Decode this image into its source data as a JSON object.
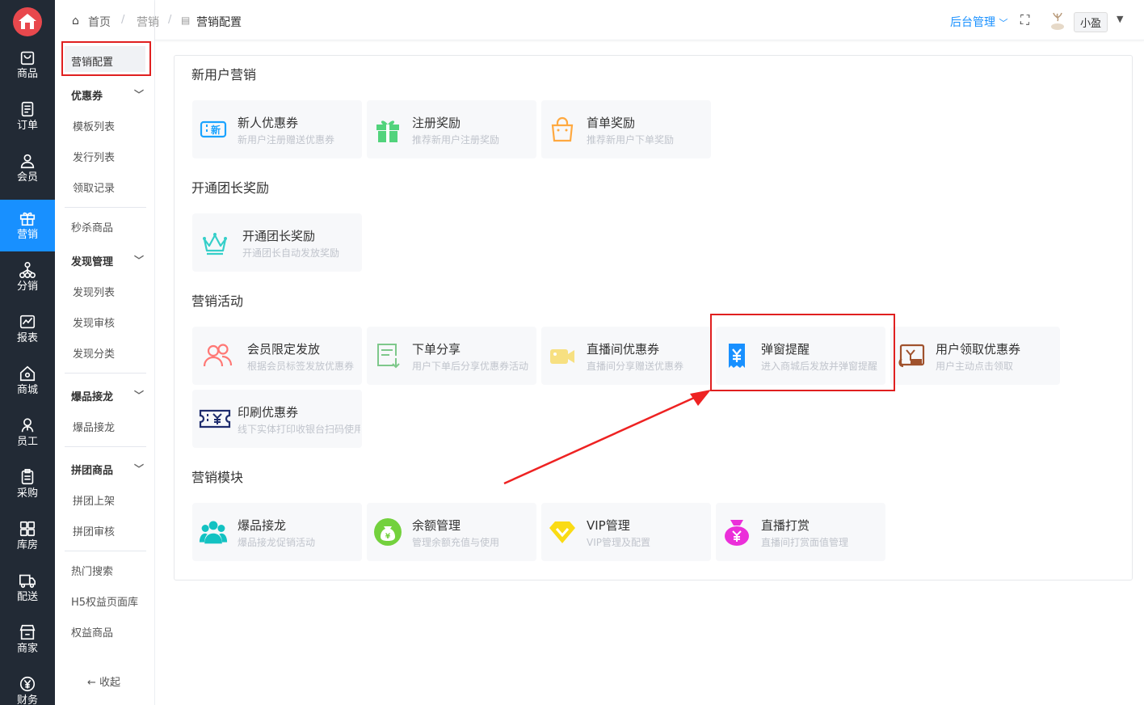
{
  "rail": {
    "items": [
      {
        "label": "商品",
        "icon": "bag-icon"
      },
      {
        "label": "订单",
        "icon": "order-icon"
      },
      {
        "label": "会员",
        "icon": "user-icon"
      },
      {
        "label": "营销",
        "icon": "gift-icon",
        "active": true
      },
      {
        "label": "分销",
        "icon": "network-icon"
      },
      {
        "label": "报表",
        "icon": "chart-icon"
      },
      {
        "label": "商城",
        "icon": "home-icon"
      },
      {
        "label": "员工",
        "icon": "staff-icon"
      },
      {
        "label": "采购",
        "icon": "clipboard-icon"
      },
      {
        "label": "库房",
        "icon": "warehouse-icon"
      },
      {
        "label": "配送",
        "icon": "truck-icon"
      },
      {
        "label": "商家",
        "icon": "store-icon"
      },
      {
        "label": "财务",
        "icon": "yen-icon"
      }
    ]
  },
  "subnav": {
    "selected": "营销配置",
    "groups": [
      {
        "title": "优惠券",
        "items": [
          "模板列表",
          "发行列表",
          "领取记录"
        ]
      },
      {
        "title": "秒杀商品",
        "items": []
      },
      {
        "title": "发现管理",
        "items": [
          "发现列表",
          "发现审核",
          "发现分类"
        ]
      },
      {
        "title": "爆品接龙",
        "items": [
          "爆品接龙"
        ]
      },
      {
        "title": "拼团商品",
        "items": [
          "拼团上架",
          "拼团审核"
        ]
      }
    ],
    "extras": [
      "热门搜索",
      "H5权益页面库",
      "权益商品"
    ],
    "collapse": "收起"
  },
  "topbar": {
    "breadcrumb": [
      "首页",
      "营销",
      "营销配置"
    ],
    "admin_menu": "后台管理",
    "username": "小盈"
  },
  "sections": [
    {
      "title": "新用户营销",
      "cards": [
        {
          "title": "新人优惠券",
          "desc": "新用户注册赠送优惠券",
          "icon": "new-coupon-icon"
        },
        {
          "title": "注册奖励",
          "desc": "推荐新用户注册奖励",
          "icon": "gift-box-icon"
        },
        {
          "title": "首单奖励",
          "desc": "推荐新用户下单奖励",
          "icon": "shopping-bag-icon"
        }
      ]
    },
    {
      "title": "开通团长奖励",
      "cards": [
        {
          "title": "开通团长奖励",
          "desc": "开通团长自动发放奖励",
          "icon": "crown-icon"
        }
      ]
    },
    {
      "title": "营销活动",
      "cards": [
        {
          "title": "会员限定发放",
          "desc": "根据会员标签发放优惠券",
          "icon": "members-icon"
        },
        {
          "title": "下单分享",
          "desc": "用户下单后分享优惠券活动",
          "icon": "share-download-icon"
        },
        {
          "title": "直播间优惠券",
          "desc": "直播间分享赠送优惠券",
          "icon": "video-camera-icon"
        },
        {
          "title": "弹窗提醒",
          "desc": "进入商城后发放并弹窗提醒",
          "icon": "yen-receipt-icon"
        },
        {
          "title": "用户领取优惠券",
          "desc": "用户主动点击领取",
          "icon": "coupon-wallet-icon"
        },
        {
          "title": "印刷优惠券",
          "desc": "线下实体打印收银台扫码使用",
          "icon": "printed-coupon-icon"
        }
      ]
    },
    {
      "title": "营销模块",
      "cards": [
        {
          "title": "爆品接龙",
          "desc": "爆品接龙促销活动",
          "icon": "group-icon"
        },
        {
          "title": "余额管理",
          "desc": "管理余额充值与使用",
          "icon": "money-bag-icon"
        },
        {
          "title": "VIP管理",
          "desc": "VIP管理及配置",
          "icon": "vip-diamond-icon"
        },
        {
          "title": "直播打赏",
          "desc": "直播间打赏面值管理",
          "icon": "reward-bag-icon"
        }
      ]
    }
  ],
  "colors": {
    "accent": "#1890ff",
    "rail": "#222a35",
    "highlight": "#e02020"
  }
}
